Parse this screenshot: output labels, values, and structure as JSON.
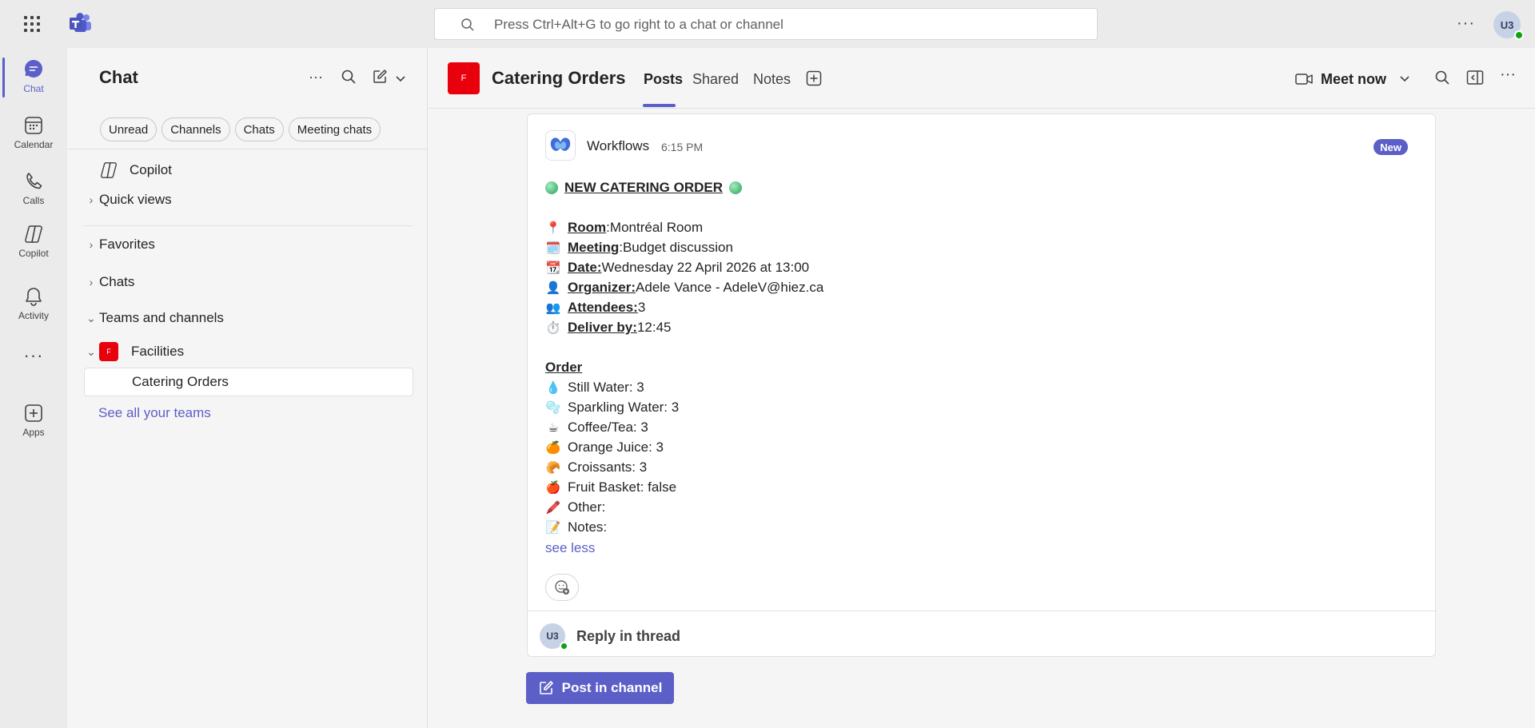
{
  "titlebar": {
    "search_placeholder": "Press Ctrl+Alt+G to go right to a chat or channel",
    "more_label": "···",
    "avatar_initials": "U3"
  },
  "rail": {
    "items": [
      {
        "label": "Chat",
        "icon": "chat-icon"
      },
      {
        "label": "Calendar",
        "icon": "calendar-icon"
      },
      {
        "label": "Calls",
        "icon": "phone-icon"
      },
      {
        "label": "Copilot",
        "icon": "copilot-icon"
      },
      {
        "label": "Activity",
        "icon": "bell-icon"
      },
      {
        "label": "···",
        "icon": "more-icon"
      },
      {
        "label": "Apps",
        "icon": "add-apps-icon"
      }
    ]
  },
  "list": {
    "title": "Chat",
    "more_label": "···",
    "pills": [
      "Unread",
      "Channels",
      "Chats",
      "Meeting chats"
    ],
    "copilot": "Copilot",
    "quick_views": "Quick views",
    "favorites": "Favorites",
    "chats": "Chats",
    "teams_and_channels": "Teams and channels",
    "team": {
      "name": "Facilities",
      "badge": "F"
    },
    "channel": "Catering Orders",
    "see_all": "See all your teams"
  },
  "channel_header": {
    "badge": "F",
    "name": "Catering Orders",
    "tabs": [
      "Posts",
      "Shared",
      "Notes"
    ],
    "meet_now": "Meet now"
  },
  "message": {
    "author": "Workflows",
    "time": "6:15 PM",
    "badge": "New",
    "heading": "NEW CATERING ORDER",
    "fields": [
      {
        "emoji": "📍",
        "label": "Room",
        "sep": ":",
        "value": " Montréal Room"
      },
      {
        "emoji": "🗓️",
        "label": "Meeting",
        "sep": ":",
        "value": " Budget discussion"
      },
      {
        "emoji": "📆",
        "label": "Date:",
        "sep": "",
        "value": " Wednesday 22 April 2026 at 13:00"
      },
      {
        "emoji": "👤",
        "label": "Organizer:",
        "sep": "",
        "value": " Adele Vance - AdeleV@hiez.ca"
      },
      {
        "emoji": "👥",
        "label": "Attendees:",
        "sep": "",
        "value": " 3"
      },
      {
        "emoji": "⏱️",
        "label": "Deliver by:",
        "sep": "",
        "value": " 12:45"
      }
    ],
    "order_heading": "Order",
    "order_items": [
      {
        "emoji": "💧",
        "text": "Still Water: 3"
      },
      {
        "emoji": "🫧",
        "text": "Sparkling Water: 3"
      },
      {
        "emoji": "☕",
        "text": "Coffee/Tea: 3"
      },
      {
        "emoji": "🍊",
        "text": "Orange Juice: 3"
      },
      {
        "emoji": "🥐",
        "text": "Croissants: 3"
      },
      {
        "emoji": "🍎",
        "text": "Fruit Basket: false"
      },
      {
        "emoji": "🖍️",
        "text": "Other:"
      },
      {
        "emoji": "📝",
        "text": "Notes:"
      }
    ],
    "see_less": "see less",
    "reply_avatar": "U3",
    "reply_label": "Reply in thread"
  },
  "post_button": "Post in channel",
  "colors": {
    "accent": "#5b5fc7",
    "team_badge": "#e8000d",
    "presence": "#13a10e"
  }
}
